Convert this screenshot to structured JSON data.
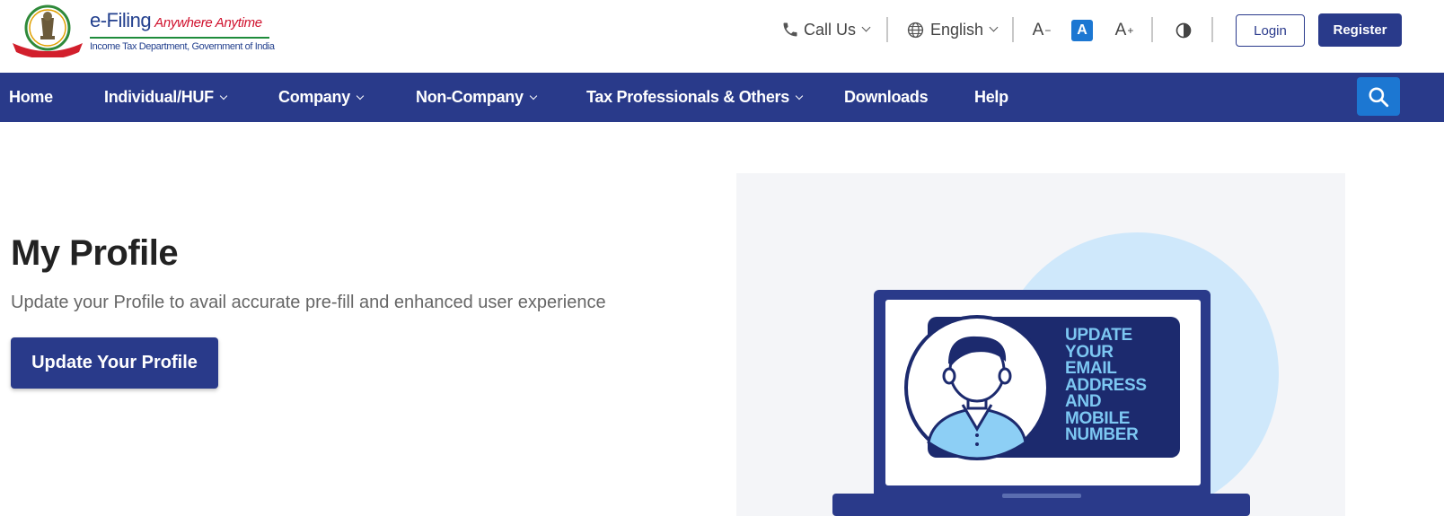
{
  "header": {
    "brand_name": "e-Filing",
    "brand_tagline": "Anywhere Anytime",
    "brand_subtitle": "Income Tax Department, Government of India",
    "call_us_label": "Call Us",
    "language_label": "English",
    "font_decrease_label": "A",
    "font_normal_label": "A",
    "font_increase_label": "A",
    "login_label": "Login",
    "register_label": "Register"
  },
  "nav": {
    "items": [
      {
        "label": "Home",
        "has_dropdown": false
      },
      {
        "label": "Individual/HUF",
        "has_dropdown": true
      },
      {
        "label": "Company",
        "has_dropdown": true
      },
      {
        "label": "Non-Company",
        "has_dropdown": true
      },
      {
        "label": "Tax Professionals & Others",
        "has_dropdown": true
      },
      {
        "label": "Downloads",
        "has_dropdown": false
      },
      {
        "label": "Help",
        "has_dropdown": false
      }
    ],
    "search_icon": "search-icon"
  },
  "main": {
    "title": "My Profile",
    "subtitle": "Update your Profile to avail accurate pre-fill and enhanced user experience",
    "cta_label": "Update Your Profile",
    "illustration_lines": [
      "UPDATE",
      "YOUR",
      "EMAIL",
      "ADDRESS",
      "AND",
      "MOBILE",
      "NUMBER"
    ]
  },
  "colors": {
    "nav_bg": "#293a8a",
    "accent_blue": "#1c77d2",
    "illustration_text": "#7cc7f2",
    "illustration_circle": "#cfe8fb"
  }
}
